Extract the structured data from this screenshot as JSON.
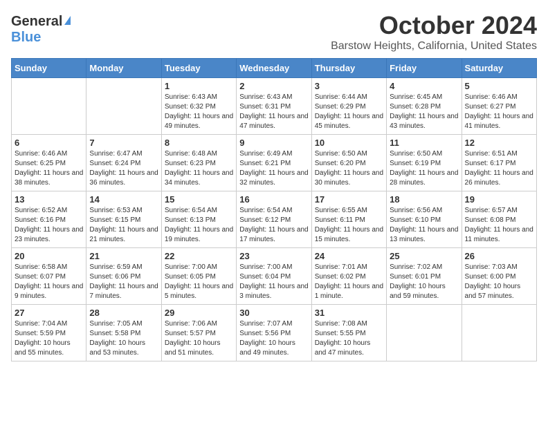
{
  "logo": {
    "general": "General",
    "blue": "Blue"
  },
  "title": {
    "month": "October 2024",
    "location": "Barstow Heights, California, United States"
  },
  "headers": [
    "Sunday",
    "Monday",
    "Tuesday",
    "Wednesday",
    "Thursday",
    "Friday",
    "Saturday"
  ],
  "weeks": [
    [
      {
        "day": "",
        "info": ""
      },
      {
        "day": "",
        "info": ""
      },
      {
        "day": "1",
        "info": "Sunrise: 6:43 AM\nSunset: 6:32 PM\nDaylight: 11 hours and 49 minutes."
      },
      {
        "day": "2",
        "info": "Sunrise: 6:43 AM\nSunset: 6:31 PM\nDaylight: 11 hours and 47 minutes."
      },
      {
        "day": "3",
        "info": "Sunrise: 6:44 AM\nSunset: 6:29 PM\nDaylight: 11 hours and 45 minutes."
      },
      {
        "day": "4",
        "info": "Sunrise: 6:45 AM\nSunset: 6:28 PM\nDaylight: 11 hours and 43 minutes."
      },
      {
        "day": "5",
        "info": "Sunrise: 6:46 AM\nSunset: 6:27 PM\nDaylight: 11 hours and 41 minutes."
      }
    ],
    [
      {
        "day": "6",
        "info": "Sunrise: 6:46 AM\nSunset: 6:25 PM\nDaylight: 11 hours and 38 minutes."
      },
      {
        "day": "7",
        "info": "Sunrise: 6:47 AM\nSunset: 6:24 PM\nDaylight: 11 hours and 36 minutes."
      },
      {
        "day": "8",
        "info": "Sunrise: 6:48 AM\nSunset: 6:23 PM\nDaylight: 11 hours and 34 minutes."
      },
      {
        "day": "9",
        "info": "Sunrise: 6:49 AM\nSunset: 6:21 PM\nDaylight: 11 hours and 32 minutes."
      },
      {
        "day": "10",
        "info": "Sunrise: 6:50 AM\nSunset: 6:20 PM\nDaylight: 11 hours and 30 minutes."
      },
      {
        "day": "11",
        "info": "Sunrise: 6:50 AM\nSunset: 6:19 PM\nDaylight: 11 hours and 28 minutes."
      },
      {
        "day": "12",
        "info": "Sunrise: 6:51 AM\nSunset: 6:17 PM\nDaylight: 11 hours and 26 minutes."
      }
    ],
    [
      {
        "day": "13",
        "info": "Sunrise: 6:52 AM\nSunset: 6:16 PM\nDaylight: 11 hours and 23 minutes."
      },
      {
        "day": "14",
        "info": "Sunrise: 6:53 AM\nSunset: 6:15 PM\nDaylight: 11 hours and 21 minutes."
      },
      {
        "day": "15",
        "info": "Sunrise: 6:54 AM\nSunset: 6:13 PM\nDaylight: 11 hours and 19 minutes."
      },
      {
        "day": "16",
        "info": "Sunrise: 6:54 AM\nSunset: 6:12 PM\nDaylight: 11 hours and 17 minutes."
      },
      {
        "day": "17",
        "info": "Sunrise: 6:55 AM\nSunset: 6:11 PM\nDaylight: 11 hours and 15 minutes."
      },
      {
        "day": "18",
        "info": "Sunrise: 6:56 AM\nSunset: 6:10 PM\nDaylight: 11 hours and 13 minutes."
      },
      {
        "day": "19",
        "info": "Sunrise: 6:57 AM\nSunset: 6:08 PM\nDaylight: 11 hours and 11 minutes."
      }
    ],
    [
      {
        "day": "20",
        "info": "Sunrise: 6:58 AM\nSunset: 6:07 PM\nDaylight: 11 hours and 9 minutes."
      },
      {
        "day": "21",
        "info": "Sunrise: 6:59 AM\nSunset: 6:06 PM\nDaylight: 11 hours and 7 minutes."
      },
      {
        "day": "22",
        "info": "Sunrise: 7:00 AM\nSunset: 6:05 PM\nDaylight: 11 hours and 5 minutes."
      },
      {
        "day": "23",
        "info": "Sunrise: 7:00 AM\nSunset: 6:04 PM\nDaylight: 11 hours and 3 minutes."
      },
      {
        "day": "24",
        "info": "Sunrise: 7:01 AM\nSunset: 6:02 PM\nDaylight: 11 hours and 1 minute."
      },
      {
        "day": "25",
        "info": "Sunrise: 7:02 AM\nSunset: 6:01 PM\nDaylight: 10 hours and 59 minutes."
      },
      {
        "day": "26",
        "info": "Sunrise: 7:03 AM\nSunset: 6:00 PM\nDaylight: 10 hours and 57 minutes."
      }
    ],
    [
      {
        "day": "27",
        "info": "Sunrise: 7:04 AM\nSunset: 5:59 PM\nDaylight: 10 hours and 55 minutes."
      },
      {
        "day": "28",
        "info": "Sunrise: 7:05 AM\nSunset: 5:58 PM\nDaylight: 10 hours and 53 minutes."
      },
      {
        "day": "29",
        "info": "Sunrise: 7:06 AM\nSunset: 5:57 PM\nDaylight: 10 hours and 51 minutes."
      },
      {
        "day": "30",
        "info": "Sunrise: 7:07 AM\nSunset: 5:56 PM\nDaylight: 10 hours and 49 minutes."
      },
      {
        "day": "31",
        "info": "Sunrise: 7:08 AM\nSunset: 5:55 PM\nDaylight: 10 hours and 47 minutes."
      },
      {
        "day": "",
        "info": ""
      },
      {
        "day": "",
        "info": ""
      }
    ]
  ]
}
